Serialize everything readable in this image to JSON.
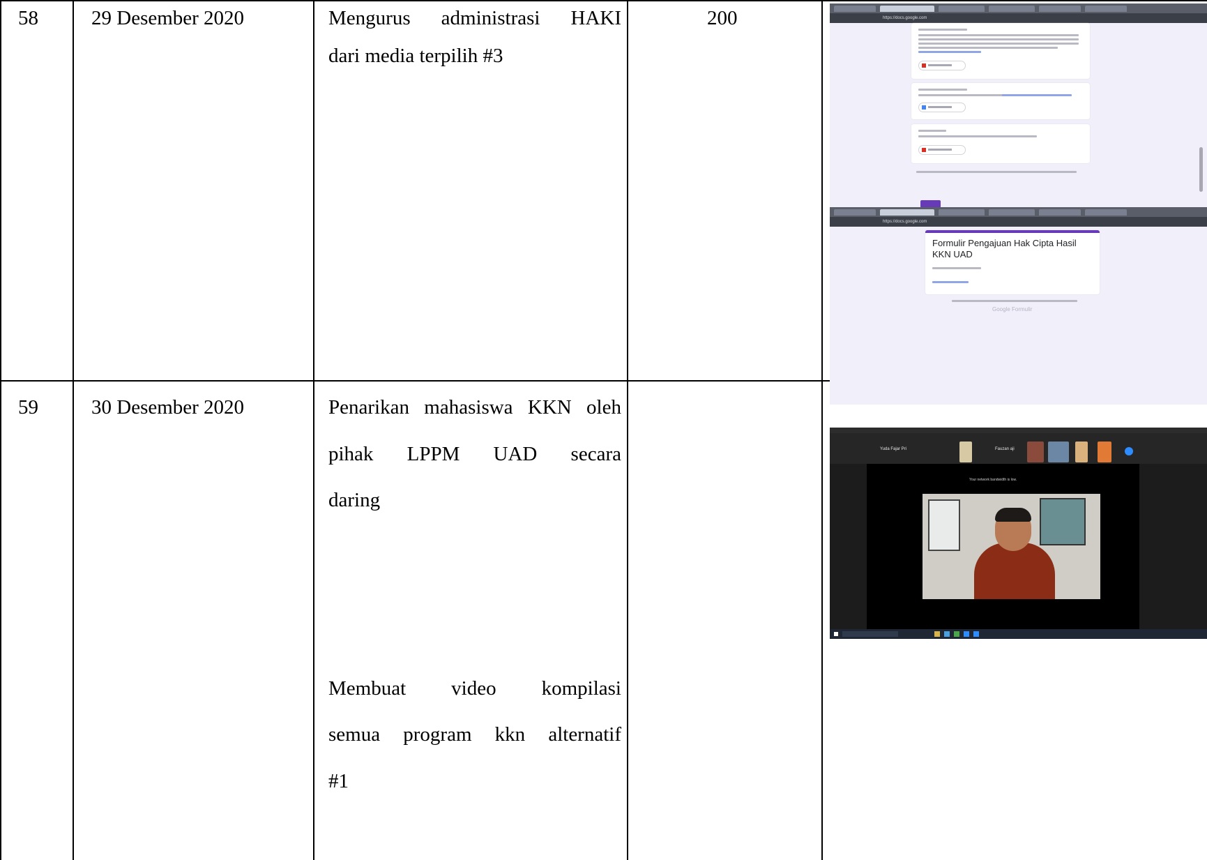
{
  "rows": [
    {
      "no": "58",
      "date": "29 Desember 2020",
      "activity_lines": [
        "Mengurus administrasi HAKI",
        "dari media terpilih #3"
      ],
      "amount": "200"
    },
    {
      "no": "59",
      "date": "30 Desember 2020",
      "activity_lines": [
        "Penarikan mahasiswa KKN oleh",
        "pihak LPPM UAD secara",
        "daring"
      ],
      "activity2_lines": [
        "Membuat video kompilasi",
        "semua program kkn alternatif",
        "#1"
      ],
      "amount": ""
    }
  ],
  "screenshot1": {
    "url": "https://docs.google.com",
    "form_title": "Formulir Pengajuan Hak Cipta Hasil KKN UAD",
    "google_forms_label": "Google Formulir",
    "accent_color": "#673ab7",
    "background_color": "#f1eff9"
  },
  "screenshot2": {
    "participant_1": "Yuda Fajar Pri",
    "participant_2": "Fauzan aji",
    "network_notice": "Your network bandwidth is low."
  }
}
